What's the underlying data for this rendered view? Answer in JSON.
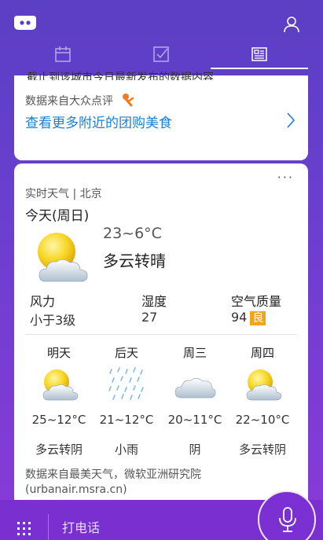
{
  "card_dianping": {
    "cut_text": "截止到该城市今日最新发布的数据内容",
    "source": "数据来自大众点评",
    "link": "查看更多附近的团购美食"
  },
  "weather": {
    "more": "···",
    "title": "实时天气 | 北京",
    "today": "今天(周日)",
    "temp_range": "23~6°C",
    "condition": "多云转晴",
    "wind_label": "风力",
    "wind_value": "小于3级",
    "humidity_label": "湿度",
    "humidity_value": "27",
    "aqi_label": "空气质量",
    "aqi_value": "94",
    "aqi_level": "良",
    "forecast": [
      {
        "day": "明天",
        "temp": "25~12°C",
        "cond": "多云转阴",
        "icon": "partly-cloudy-icon"
      },
      {
        "day": "后天",
        "temp": "21~12°C",
        "cond": "小雨",
        "icon": "light-rain-icon"
      },
      {
        "day": "周三",
        "temp": "20~11°C",
        "cond": "阴",
        "icon": "overcast-icon"
      },
      {
        "day": "周四",
        "temp": "22~10°C",
        "cond": "多云转阴",
        "icon": "partly-cloudy-icon"
      }
    ],
    "source": "数据来自最美天气，微软亚洲研究院 (urbanair.msra.cn)"
  },
  "bottom": {
    "call_label": "打电话"
  },
  "colors": {
    "accent_purple": "#7a30d2",
    "link_blue": "#1a7fd4",
    "aqi_orange": "#f2a516"
  }
}
